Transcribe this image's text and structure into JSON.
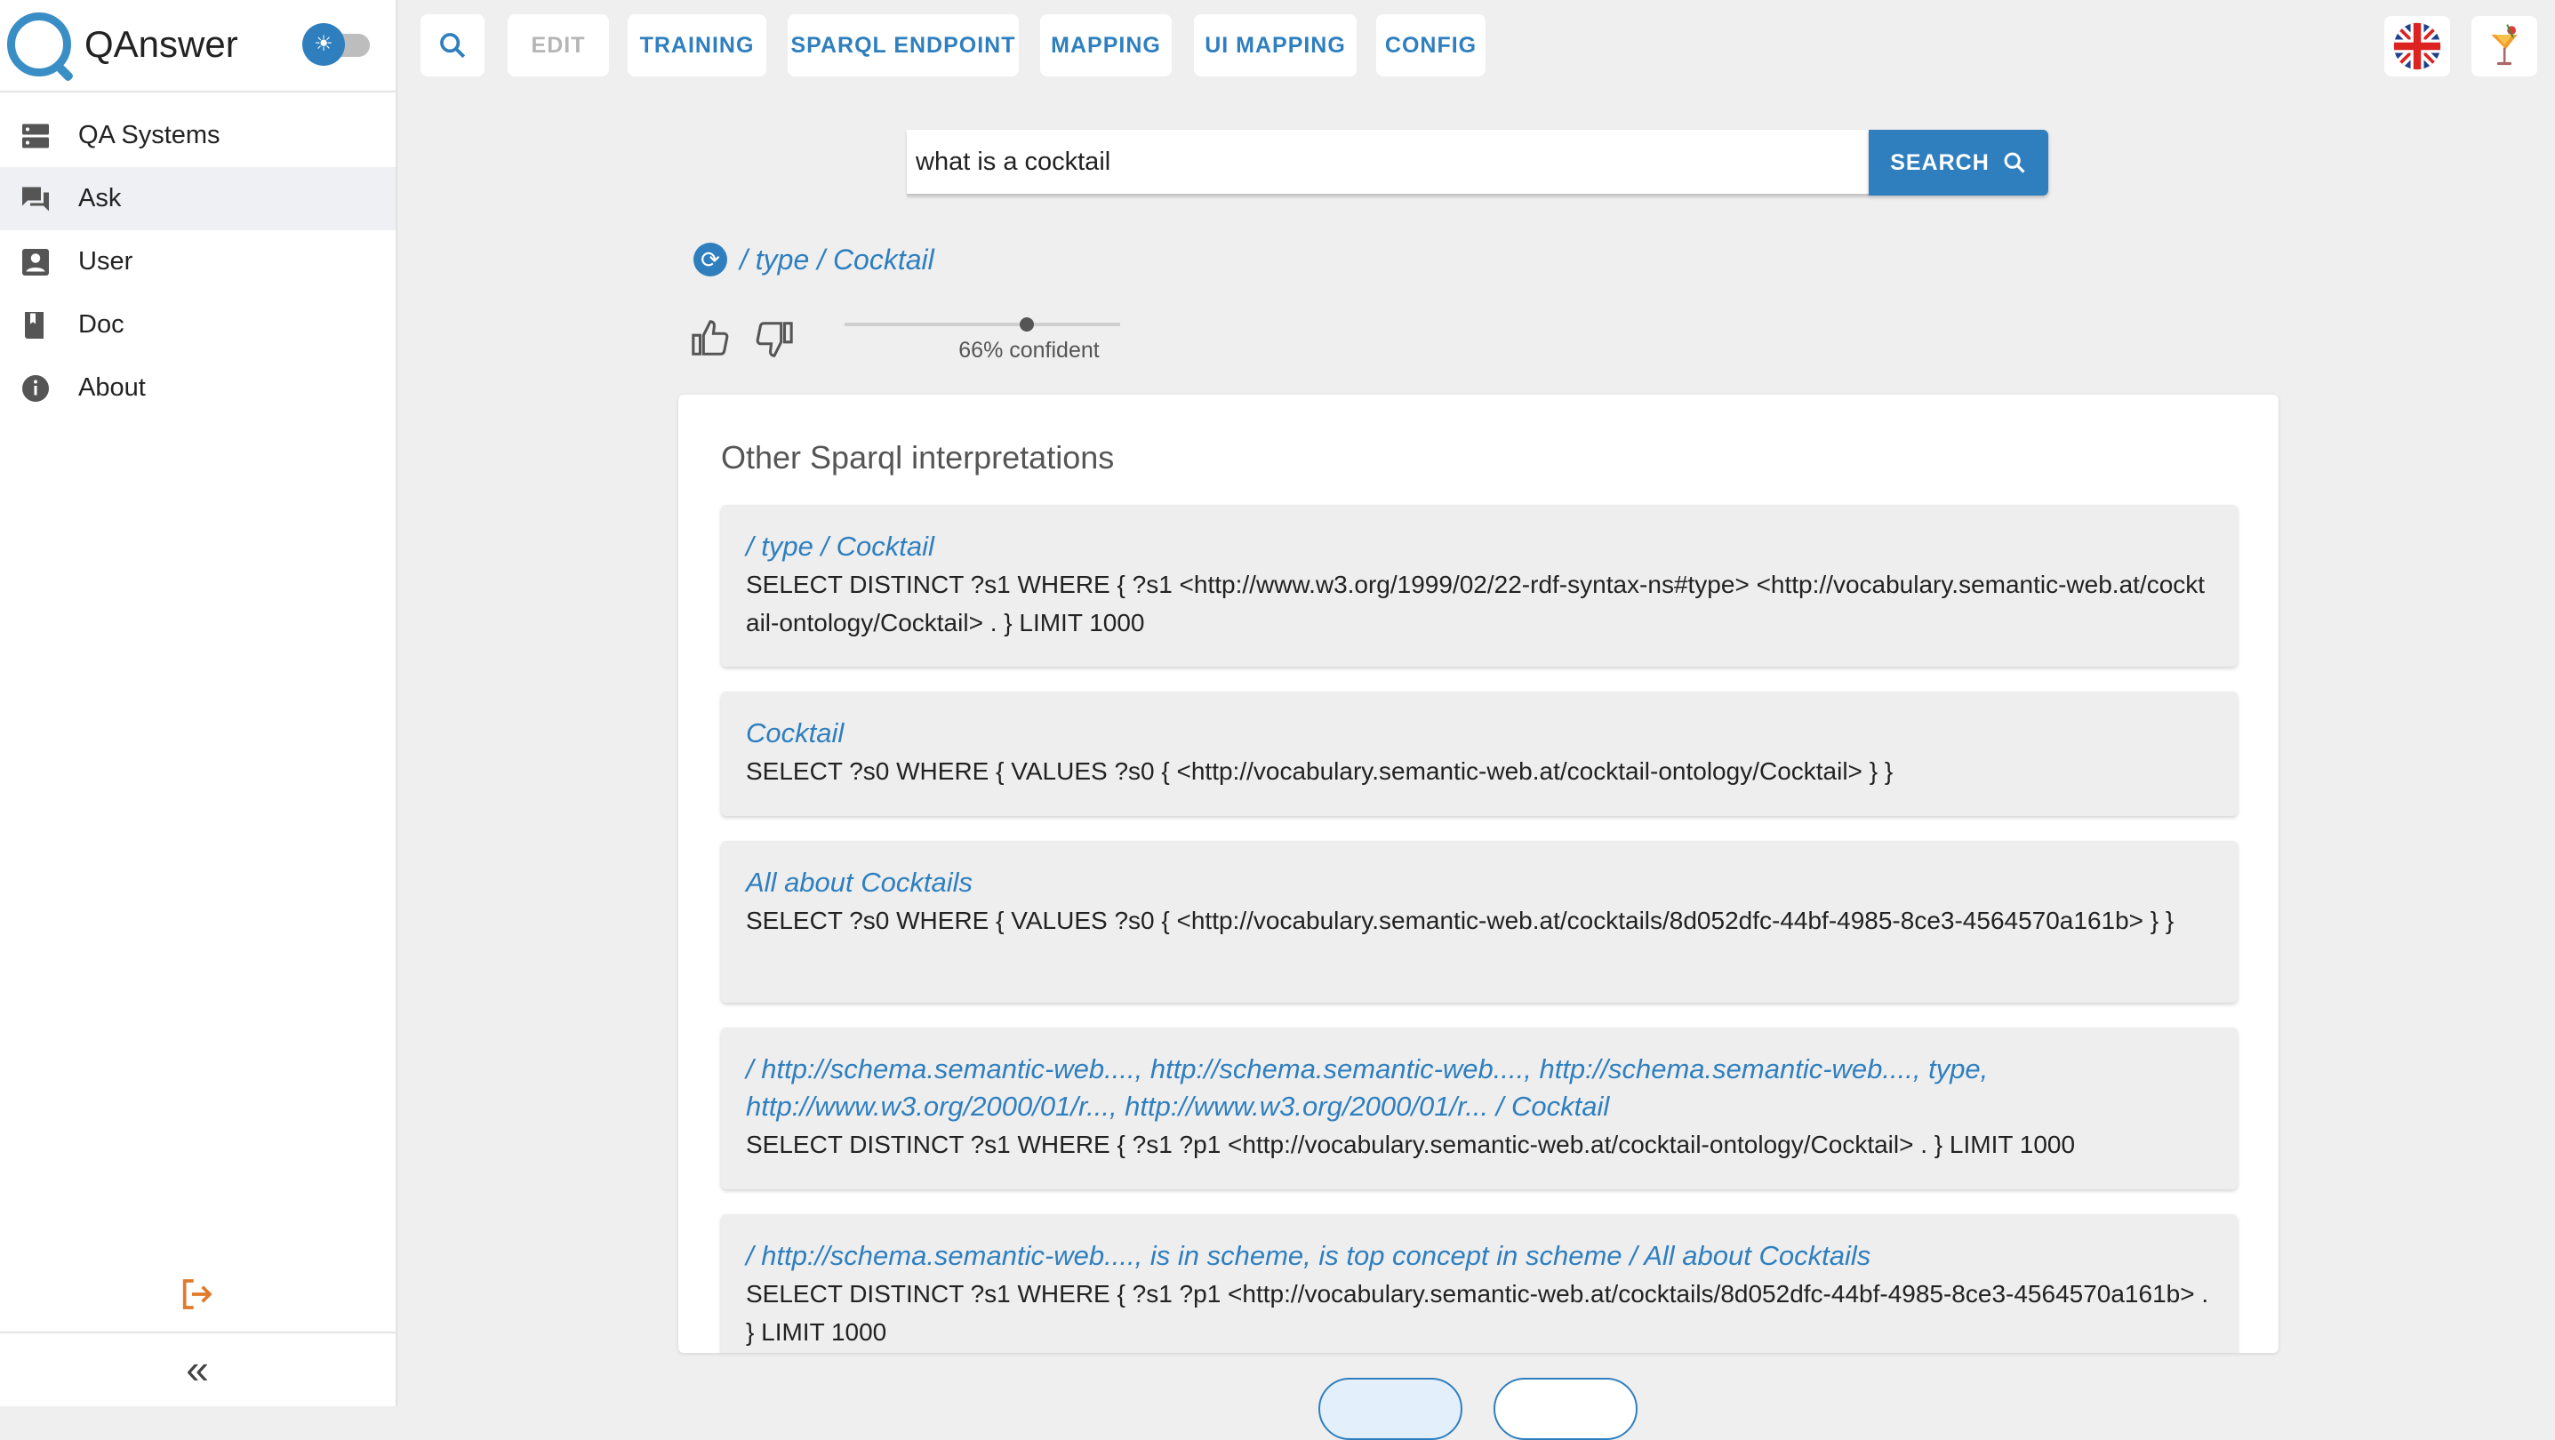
{
  "app": {
    "title": "QAnswer"
  },
  "sidebar": {
    "items": [
      {
        "label": "QA Systems",
        "icon": "server-icon"
      },
      {
        "label": "Ask",
        "icon": "chat-icon"
      },
      {
        "label": "User",
        "icon": "user-badge-icon"
      },
      {
        "label": "Doc",
        "icon": "book-icon"
      },
      {
        "label": "About",
        "icon": "info-icon"
      }
    ],
    "active": "Ask"
  },
  "toolbar": {
    "edit": "EDIT",
    "training": "TRAINING",
    "sparql_endpoint": "SPARQL ENDPOINT",
    "mapping": "MAPPING",
    "ui_mapping": "UI MAPPING",
    "config": "CONFIG"
  },
  "search": {
    "value": "what is a cocktail",
    "button": "SEARCH"
  },
  "answer": {
    "path": "/ type / Cocktail",
    "confidence_label": "66% confident",
    "confidence": 0.66
  },
  "interpretations": {
    "title": "Other Sparql interpretations",
    "items": [
      {
        "title": "/ type / Cocktail",
        "query": "SELECT DISTINCT ?s1 WHERE { ?s1 <http://www.w3.org/1999/02/22-rdf-syntax-ns#type> <http://vocabulary.semantic-web.at/cocktail-ontology/Cocktail> . } LIMIT 1000"
      },
      {
        "title": "Cocktail",
        "query": "SELECT ?s0 WHERE { VALUES ?s0 { <http://vocabulary.semantic-web.at/cocktail-ontology/Cocktail> } }"
      },
      {
        "title": "All about Cocktails",
        "query": "SELECT ?s0 WHERE { VALUES ?s0 { <http://vocabulary.semantic-web.at/cocktails/8d052dfc-44bf-4985-8ce3-4564570a161b> } }"
      },
      {
        "title": "/ http://schema.semantic-web...., http://schema.semantic-web...., http://schema.semantic-web...., type, http://www.w3.org/2000/01/r..., http://www.w3.org/2000/01/r... / Cocktail",
        "query": "SELECT DISTINCT ?s1 WHERE { ?s1 ?p1 <http://vocabulary.semantic-web.at/cocktail-ontology/Cocktail> . } LIMIT 1000"
      },
      {
        "title": "/ http://schema.semantic-web...., is in scheme, is top concept in scheme / All about Cocktails",
        "query": "SELECT DISTINCT ?s1 WHERE { ?s1 ?p1 <http://vocabulary.semantic-web.at/cocktails/8d052dfc-44bf-4985-8ce3-4564570a161b> . } LIMIT 1000"
      }
    ]
  },
  "colors": {
    "accent": "#2f7fbf",
    "logout": "#e07a2a",
    "background": "#efefef"
  }
}
